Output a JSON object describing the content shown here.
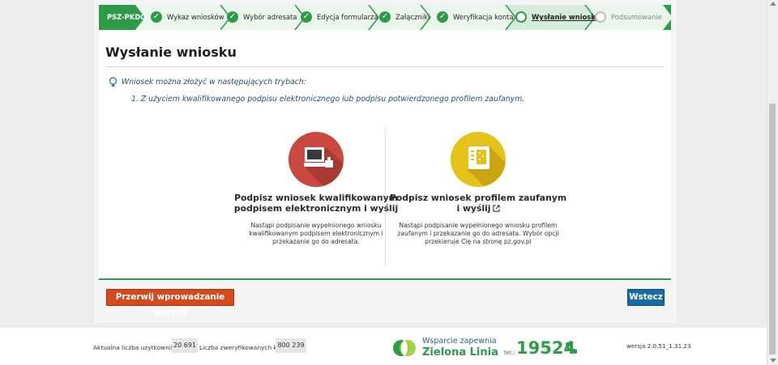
{
  "steps": {
    "first": "PSZ-PKDG",
    "items": [
      {
        "label": "Wykaz wniosków",
        "state": "done"
      },
      {
        "label": "Wybór adresata",
        "state": "done"
      },
      {
        "label": "Edycja formularza",
        "state": "done"
      },
      {
        "label": "Załączniki",
        "state": "done"
      },
      {
        "label": "Weryfikacja konta",
        "state": "done"
      },
      {
        "label": "Wysłanie wniosku",
        "state": "active"
      },
      {
        "label": "Podsumowanie",
        "state": "pending"
      }
    ]
  },
  "page": {
    "title": "Wysłanie wniosku",
    "info": "Wniosek można złożyć w następujących trybach:",
    "mode1": "1. Z użyciem kwalifikowanego podpisu elektronicznego lub podpisu potwierdzonego profilem zaufanym."
  },
  "options": [
    {
      "title_line1": "Podpisz wniosek kwalifikowanym",
      "title_line2": "podpisem elektronicznym i wyślij",
      "desc": [
        "Nastąpi podpisanie wypełnionego wniosku",
        "kwalifikowanym podpisem elektronicznym i",
        "przekazanie go do adresata."
      ],
      "color": "#c9483f"
    },
    {
      "title_line1": "Podpisz wniosek profilem zaufanym",
      "title_line2": "i wyślij",
      "desc": [
        "Nastąpi podpisanie wypełnionego wniosku profilem",
        "zaufanym i przekazanie go do adresata. Wybór opcji",
        "przekieruje Cię na stronę pz.gov.pl"
      ],
      "color": "#e5c21a"
    }
  ],
  "buttons": {
    "abort": "Przerwij wprowadzanie danych",
    "back": "Wstecz"
  },
  "footer": {
    "users_label": "Aktualna liczba użytkowników:",
    "users_value": "20 691",
    "verified_label": "Liczba zweryfikowanych kont:",
    "verified_value": "800 239",
    "support_line1": "Wsparcie zapewnia",
    "support_line2": "Zielona Linia",
    "tel_label": "tel.:",
    "tel_number": "19524",
    "version": "wersja 2.0.51_1.31.23"
  },
  "colors": {
    "brand_green": "#2e9b48",
    "abort_red": "#d44a1d",
    "back_blue": "#1a6aa4"
  }
}
